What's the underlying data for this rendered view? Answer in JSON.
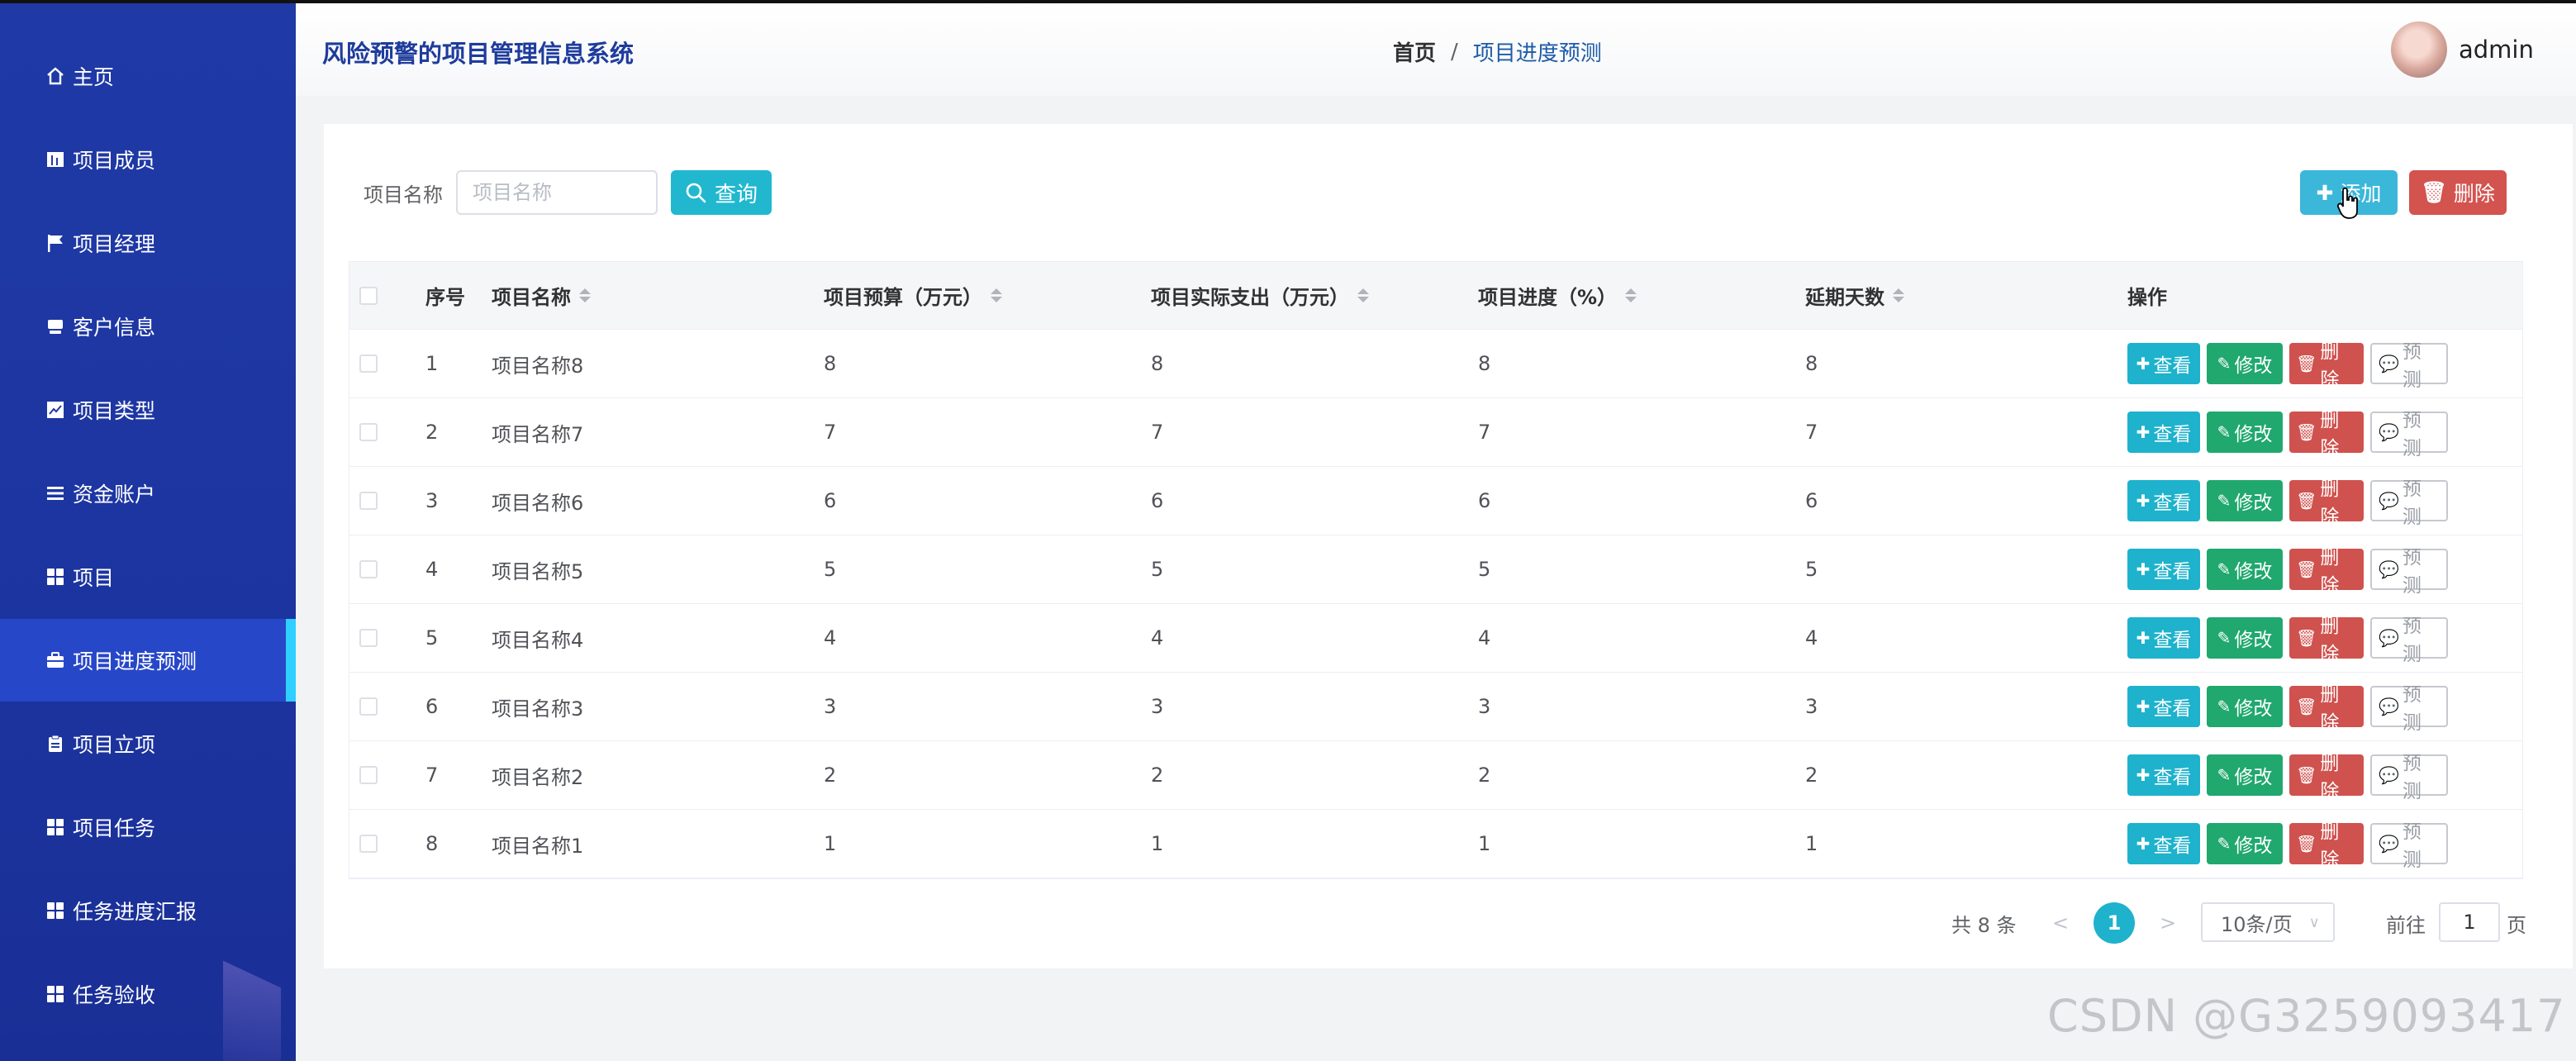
{
  "app_title": "风险预警的项目管理信息系统",
  "breadcrumb": {
    "home": "首页",
    "separator": "/",
    "current": "项目进度预测"
  },
  "user": {
    "name": "admin"
  },
  "sidebar": {
    "items": [
      {
        "label": "主页",
        "icon": "home-icon"
      },
      {
        "label": "项目成员",
        "icon": "chart-bars-icon"
      },
      {
        "label": "项目经理",
        "icon": "flag-icon"
      },
      {
        "label": "客户信息",
        "icon": "computer-icon"
      },
      {
        "label": "项目类型",
        "icon": "line-chart-icon"
      },
      {
        "label": "资金账户",
        "icon": "list-icon"
      },
      {
        "label": "项目",
        "icon": "grid-icon"
      },
      {
        "label": "项目进度预测",
        "icon": "briefcase-icon",
        "active": true
      },
      {
        "label": "项目立项",
        "icon": "clipboard-icon"
      },
      {
        "label": "项目任务",
        "icon": "grid-icon"
      },
      {
        "label": "任务进度汇报",
        "icon": "grid-icon"
      },
      {
        "label": "任务验收",
        "icon": "grid-icon"
      }
    ]
  },
  "search": {
    "label": "项目名称",
    "placeholder": "项目名称",
    "value": "",
    "button": "查询"
  },
  "toolbar": {
    "add_label": "添加",
    "delete_label": "删除"
  },
  "table": {
    "headers": [
      "序号",
      "项目名称",
      "项目预算（万元）",
      "项目实际支出（万元）",
      "项目进度（%）",
      "延期天数",
      "操作"
    ],
    "rows": [
      [
        "1",
        "项目名称8",
        "8",
        "8",
        "8",
        "8"
      ],
      [
        "2",
        "项目名称7",
        "7",
        "7",
        "7",
        "7"
      ],
      [
        "3",
        "项目名称6",
        "6",
        "6",
        "6",
        "6"
      ],
      [
        "4",
        "项目名称5",
        "5",
        "5",
        "5",
        "5"
      ],
      [
        "5",
        "项目名称4",
        "4",
        "4",
        "4",
        "4"
      ],
      [
        "6",
        "项目名称3",
        "3",
        "3",
        "3",
        "3"
      ],
      [
        "7",
        "项目名称2",
        "2",
        "2",
        "2",
        "2"
      ],
      [
        "8",
        "项目名称1",
        "1",
        "1",
        "1",
        "1"
      ]
    ],
    "actions": {
      "view": "查看",
      "edit": "修改",
      "delete": "删除",
      "predict": "预测"
    }
  },
  "pagination": {
    "total": "共 8 条",
    "prev": "<",
    "current": "1",
    "next": ">",
    "page_size": "10条/页",
    "goto": "前往",
    "goto_value": "1",
    "unit": "页"
  },
  "colors": {
    "sidebar": "#1f3aa6",
    "accent": "#1eb2cc",
    "edit": "#20a86e",
    "danger": "#cf524e",
    "active_bar": "#2fd0ff"
  },
  "watermark": "CSDN @G3259093417"
}
